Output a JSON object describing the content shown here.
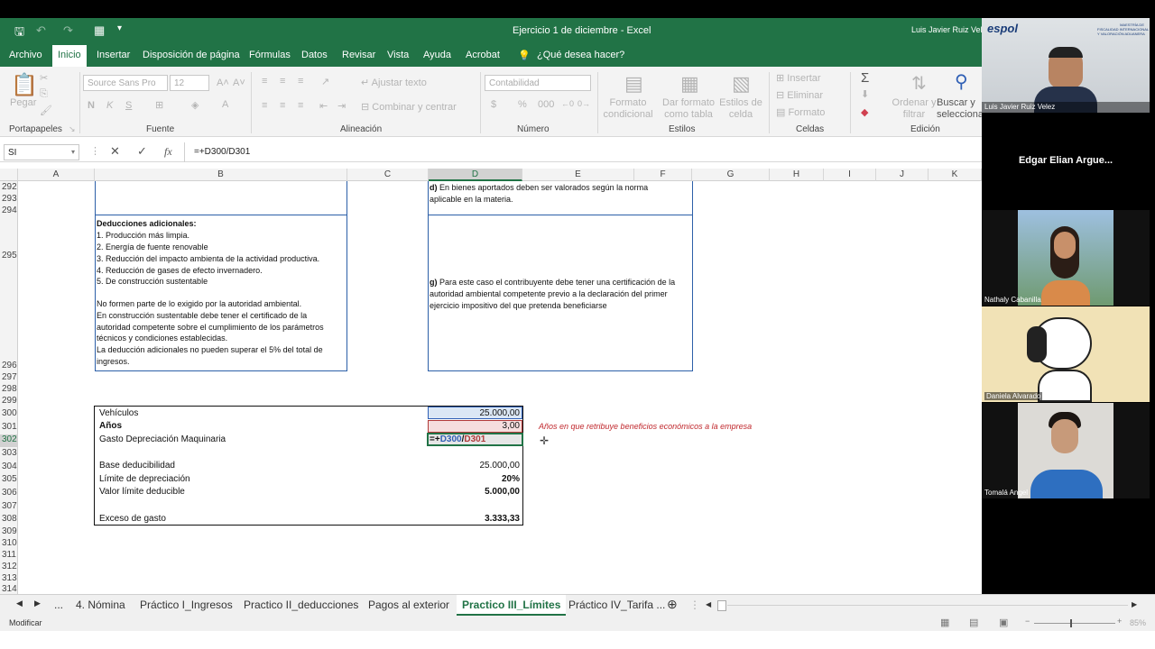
{
  "window": {
    "title": "Ejercicio 1 de diciembre  -  Excel",
    "user": "Luis Javier Ruiz Velez"
  },
  "menu": [
    "Archivo",
    "Inicio",
    "Insertar",
    "Disposición de página",
    "Fórmulas",
    "Datos",
    "Revisar",
    "Vista",
    "Ayuda",
    "Acrobat",
    "¿Qué desea hacer?"
  ],
  "ribbon": {
    "paste": "Pegar",
    "font_name": "Source Sans Pro",
    "font_size": "12",
    "wrap_text": "Ajustar texto",
    "merge": "Combinar y centrar",
    "number_format": "Contabilidad",
    "cond_format": "Formato\ncondicional",
    "as_table": "Dar formato\ncomo tabla",
    "cell_styles": "Estilos de\ncelda",
    "insert": "Insertar",
    "delete": "Eliminar",
    "format": "Formato",
    "sort": "Ordenar y\nfiltrar",
    "find": "Buscar y\nseleccionar",
    "groups": [
      "Portapapeles",
      "Fuente",
      "Alineación",
      "Número",
      "Estilos",
      "Celdas",
      "Edición"
    ]
  },
  "formula_bar": {
    "name_box": "SI",
    "fx": "fx",
    "formula": "=+D300/D301"
  },
  "columns": [
    "A",
    "B",
    "C",
    "D",
    "E",
    "F",
    "G",
    "H",
    "I",
    "J",
    "K"
  ],
  "rows": [
    "292",
    "293",
    "294",
    "295",
    "296",
    "297",
    "298",
    "299",
    "300",
    "301",
    "302",
    "303",
    "304",
    "305",
    "306",
    "307",
    "308",
    "309",
    "310",
    "311",
    "312",
    "313",
    "314"
  ],
  "sheet": {
    "d_note_label": "d)",
    "d_note": "En bienes aportados deben ser valorados según la norma\naplicable en la materia.",
    "deductions_title": "Deducciones adicionales:",
    "deductions_list": [
      "1. Producción más limpia.",
      "2. Energía de fuente renovable",
      "3. Reducción del impacto ambienta de la actividad  productiva.",
      "4. Reducción de gases de efecto invernadero.",
      "5. De construcción sustentable"
    ],
    "deductions_notes": [
      "No formen parte de lo exigido por la autoridad ambiental.",
      "En construcción sustentable debe tener el certificado de la",
      "autoridad competente  sobre el cumplimiento de los parámetros",
      "técnicos y condiciones establecidas.",
      "La deducción adicionales no pueden superar el 5% del total de",
      "ingresos."
    ],
    "g_note_label": "g)",
    "g_note": "Para este caso el contribuyente debe tener una certificación de la\nautoridad ambiental competente previo a la declaración del primer\nejercicio impositivo del que pretenda beneficiarse",
    "vehiculos_label": "Vehículos",
    "vehiculos_value": "25.000,00",
    "anos_label": "Años",
    "anos_value": "3,00",
    "anos_note": "Años en que retribuye beneficios económicos a la empresa",
    "gasto_label": "Gasto Depreciación Maquinaria",
    "edit_prefix": "=+",
    "edit_ref1": "D300",
    "edit_slash": "/",
    "edit_ref2": "D301",
    "base_label": "Base deducibilidad",
    "base_value": "25.000,00",
    "limite_label": "Límite de depreciación",
    "limite_value": "20%",
    "valor_label": "Valor límite deducible",
    "valor_value": "5.000,00",
    "exceso_label": "Exceso de gasto",
    "exceso_value": "3.333,33"
  },
  "tabs": [
    "...",
    "4. Nómina",
    "Práctico I_Ingresos",
    "Practico II_deducciones",
    "Pagos al exterior",
    "Practico III_Límites",
    "Práctico IV_Tarifa ..."
  ],
  "status": {
    "mode": "Modificar",
    "zoom": "85%"
  },
  "participants": [
    {
      "name": "Luis Javier Ruiz Velez"
    },
    {
      "name": "Edgar Elian Argue..."
    },
    {
      "name": "Nathaly Cabanilla"
    },
    {
      "name": "Daniela Alvarado"
    },
    {
      "name": "Tomalá Angel"
    }
  ],
  "logo": {
    "text": "espol",
    "subtitle": "MAESTRÍA DE\nFISCALIDAD INTERNACIONAL\nY VALORACIÓN ADUANERA"
  },
  "colors": {
    "excel_green": "#217346",
    "ref_blue": "#2f5fb5",
    "ref_red": "#b03a3a",
    "note_red": "#c0282d"
  }
}
